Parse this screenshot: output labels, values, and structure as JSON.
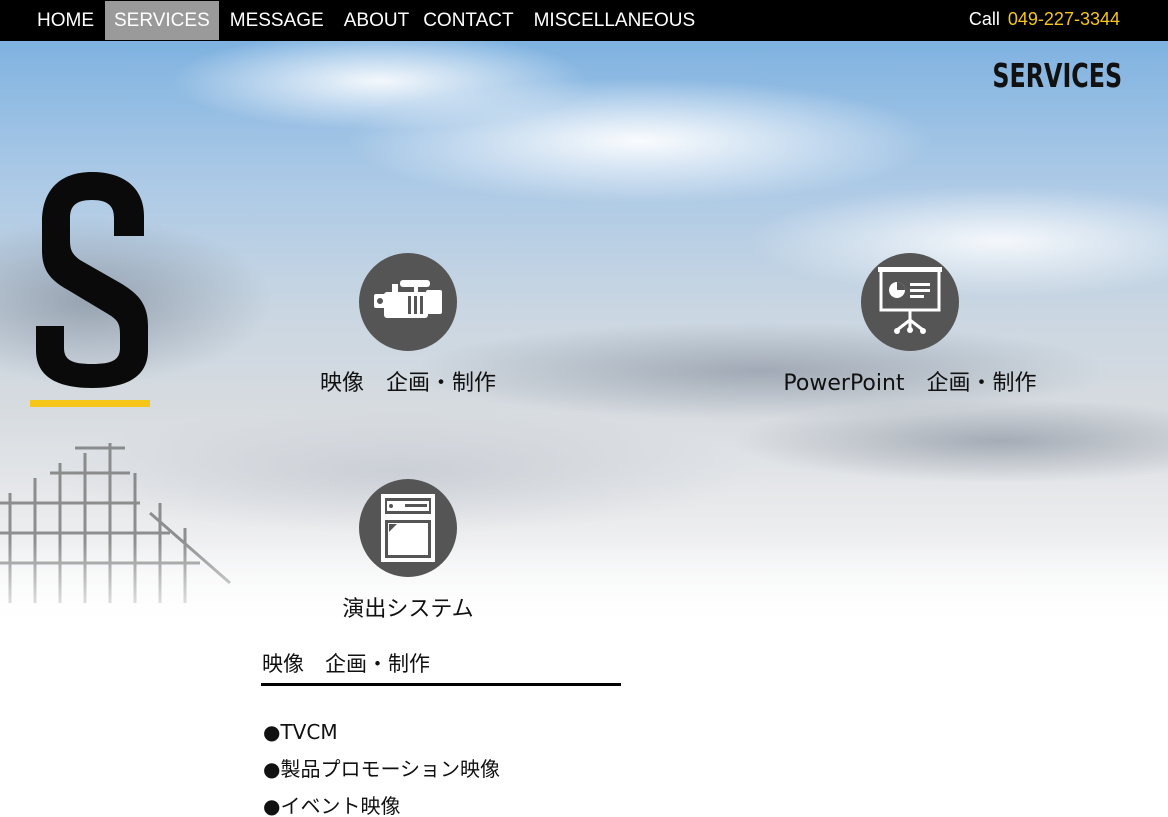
{
  "nav": {
    "items": [
      {
        "label": "HOME"
      },
      {
        "label": "SERVICES"
      },
      {
        "label": "MESSAGE"
      },
      {
        "label": "ABOUT"
      },
      {
        "label": "CONTACT"
      },
      {
        "label": "MISCELLANEOUS"
      }
    ],
    "active_item": "SERVICES",
    "call_label": "Call",
    "phone": "049-227-3344"
  },
  "hero": {
    "big_letter": "S",
    "heading": "SERVICES"
  },
  "services": [
    {
      "label": "映像　企画・制作",
      "icon": "video-camera-icon"
    },
    {
      "label": "PowerPoint　企画・制作",
      "icon": "presentation-screen-icon"
    },
    {
      "label": "演出システム",
      "icon": "av-equipment-icon"
    }
  ],
  "section": {
    "title": "映像　企画・制作",
    "items": [
      "●TVCM",
      "●製品プロモーション映像",
      "●イベント映像"
    ]
  },
  "colors": {
    "nav_bg": "#000000",
    "nav_active_bg": "#9a9a9a",
    "phone": "#f5c518",
    "accent_underline": "#f5c518",
    "icon_circle": "#555555"
  }
}
